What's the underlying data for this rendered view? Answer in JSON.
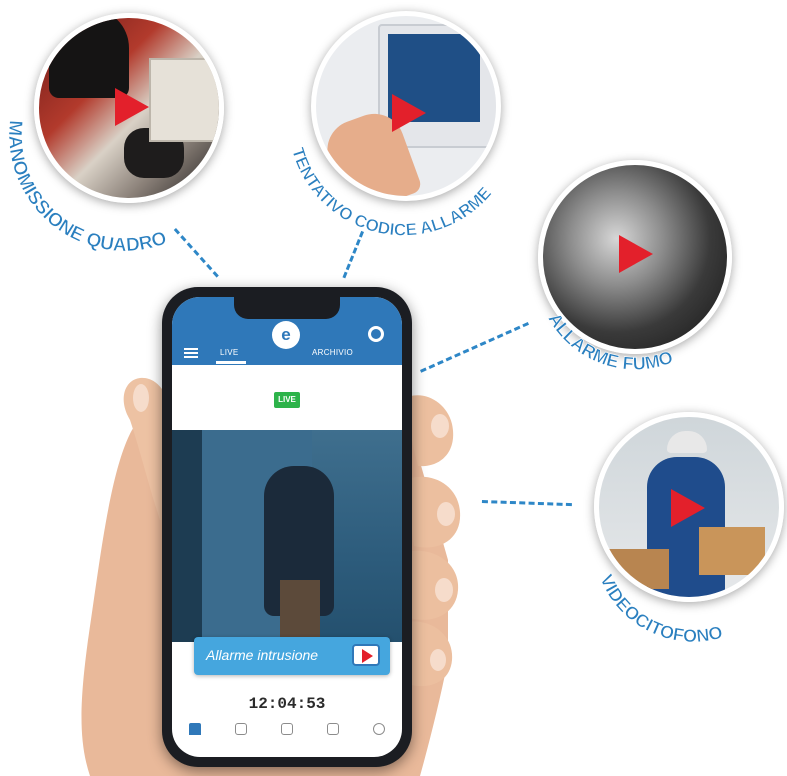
{
  "labels": {
    "manomissione": "MANOMISSIONE QUADRO",
    "tentativo": "TENTATIVO CODICE ALLARME",
    "fumo": "ALLARME FUMO",
    "videocitofono": "VIDEOCITOFONO"
  },
  "phone": {
    "header": {
      "tab_live": "LIVE",
      "tab_archive": "ARCHIVIO"
    },
    "live_badge": "LIVE",
    "alert": {
      "text": "Allarme intrusione"
    },
    "timestamp": "12:04:53"
  },
  "icons": {
    "logo": "app-logo-icon",
    "settings": "gear-icon",
    "menu": "hamburger-menu-icon",
    "alert_play": "play-icon",
    "nav": [
      "home-icon",
      "shield-icon",
      "camera-icon",
      "archive-icon",
      "info-icon"
    ]
  },
  "colors": {
    "brand_blue": "#2f78b9",
    "label_blue": "#2a7fbf",
    "alert_blue": "#45a6de",
    "live_green": "#2db34a",
    "play_red": "#e3202b"
  }
}
